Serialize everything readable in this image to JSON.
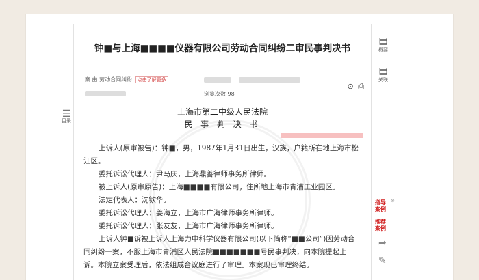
{
  "document": {
    "title": "钟■与上海■■■■仪器有限公司劳动合同纠纷二审民事判决书",
    "meta_line": "案      由 劳动合同纠纷",
    "meta_tag": "点击了解更多",
    "views_label": "浏览次数 98",
    "court": "上海市第二中级人民法院",
    "doc_type": "民 事 判 决 书",
    "paragraphs": [
      "上诉人(原审被告)：钟■，男，1987年1月31日出生，汉族，户籍所在地上海市松江区。",
      "委托诉讼代理人：尹马庆，上海鼎善律师事务所律师。",
      "被上诉人(原审原告)：上海■■■■有限公司，住所地上海市青浦工业园区。",
      "法定代表人：沈钦华。",
      "委托诉讼代理人：姜海立，上海市广海律师事务所律师。",
      "委托诉讼代理人：张友友，上海市广海律师事务所律师。",
      "上诉人钟■诉被上诉人上海力申科学仪器有限公司(以下简称“■■公司”)因劳动合同纠纷一案，不服上海市青浦区人民法院■■■■■■■号民事判决，向本院提起上诉。本院立案受理后，依法组成合议庭进行了审理。本案现已审理终结。"
    ]
  },
  "toc": {
    "label": "目录"
  },
  "sidebar": {
    "overview": "概要",
    "related": "关联",
    "guide_cases": "指导\n案例",
    "recommended_cases": "推荐\n案例"
  },
  "icons": {
    "toc": "list-icon",
    "overview": "document-icon",
    "related": "document-icon",
    "share": "share-arrow-icon",
    "edit": "pencil-icon",
    "print": "printer-icon",
    "download": "download-icon"
  }
}
